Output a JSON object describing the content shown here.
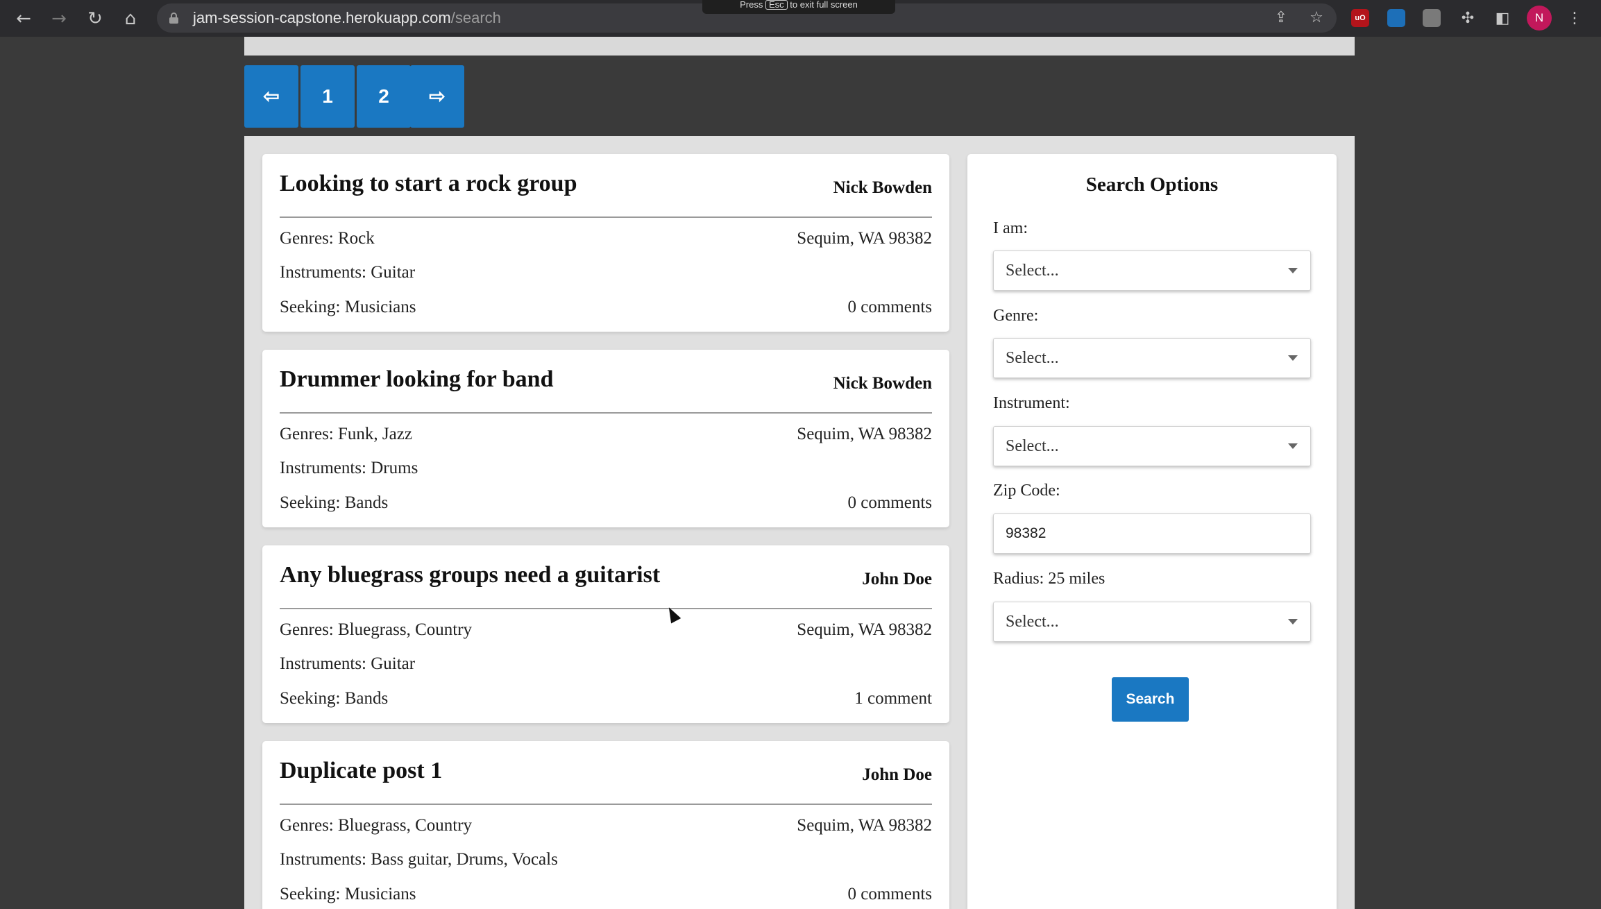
{
  "browser": {
    "url_host": "jam-session-capstone.herokuapp.com",
    "url_path": "/search",
    "fullscreen_notice_pre": "Press",
    "fullscreen_notice_key": "Esc",
    "fullscreen_notice_post": "to exit full screen",
    "profile_initial": "N",
    "icons": [
      "back-arrow-icon",
      "forward-arrow-icon",
      "reload-icon",
      "home-icon",
      "lock-icon",
      "share-icon",
      "bookmark-star-icon",
      "extensions-puzzle-icon",
      "side-panel-icon",
      "menu-kebab-icon"
    ],
    "extensions": [
      {
        "name": "ublock-icon",
        "color": "#b3141b",
        "label": "uO"
      },
      {
        "name": "vscode-extension-icon",
        "color": "#1d6fb8",
        "label": ""
      },
      {
        "name": "extension-icon",
        "color": "#7a7a7a",
        "label": ""
      }
    ]
  },
  "pagination": {
    "prev": "⇦",
    "pages": [
      "1",
      "2"
    ],
    "next": "⇨",
    "color": "#1a78c2"
  },
  "posts": [
    {
      "title": "Looking to start a rock group",
      "author": "Nick Bowden",
      "genres": "Genres: Rock",
      "instruments": "Instruments: Guitar",
      "seeking": "Seeking: Musicians",
      "location": "Sequim, WA 98382",
      "comments": "0 comments"
    },
    {
      "title": "Drummer looking for band",
      "author": "Nick Bowden",
      "genres": "Genres: Funk, Jazz",
      "instruments": "Instruments: Drums",
      "seeking": "Seeking: Bands",
      "location": "Sequim, WA 98382",
      "comments": "0 comments"
    },
    {
      "title": "Any bluegrass groups need a guitarist",
      "author": "John Doe",
      "genres": "Genres: Bluegrass, Country",
      "instruments": "Instruments: Guitar",
      "seeking": "Seeking: Bands",
      "location": "Sequim, WA 98382",
      "comments": "1 comment"
    },
    {
      "title": "Duplicate post 1",
      "author": "John Doe",
      "genres": "Genres: Bluegrass, Country",
      "instruments": "Instruments: Bass guitar, Drums, Vocals",
      "seeking": "Seeking: Musicians",
      "location": "Sequim, WA 98382",
      "comments": "0 comments"
    }
  ],
  "search": {
    "title": "Search Options",
    "i_am_label": "I am:",
    "i_am_value": "Select...",
    "genre_label": "Genre:",
    "genre_value": "Select...",
    "instrument_label": "Instrument:",
    "instrument_value": "Select...",
    "zip_label": "Zip Code:",
    "zip_value": "98382",
    "radius_label": "Radius: 25 miles",
    "radius_value": "Select...",
    "button": "Search",
    "button_color": "#1a78c2"
  }
}
